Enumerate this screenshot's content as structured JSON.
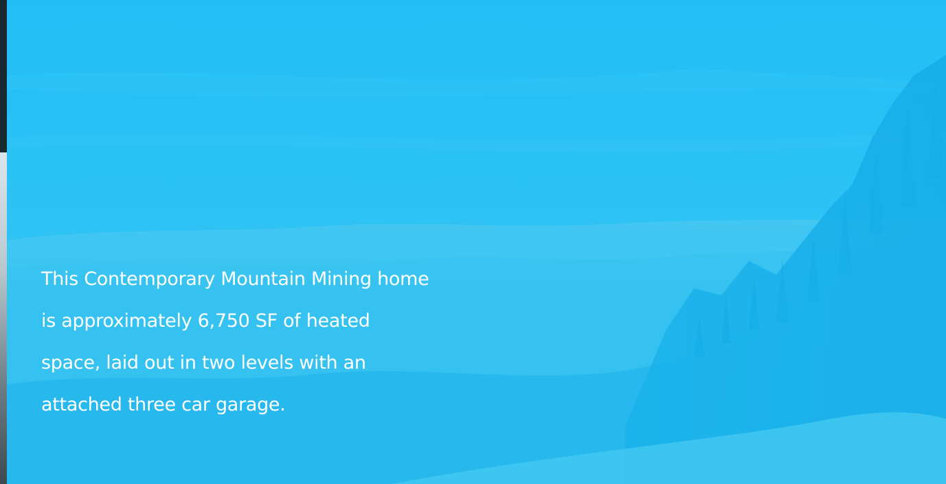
{
  "hero": {
    "description_lines": [
      "This Contemporary Mountain Mining home",
      "is approximately 6,750 SF of heated",
      "space, laid out in two levels with an",
      "attached three car garage."
    ],
    "tint_color": "#1fb5ef",
    "text_color": "#ffffff"
  }
}
